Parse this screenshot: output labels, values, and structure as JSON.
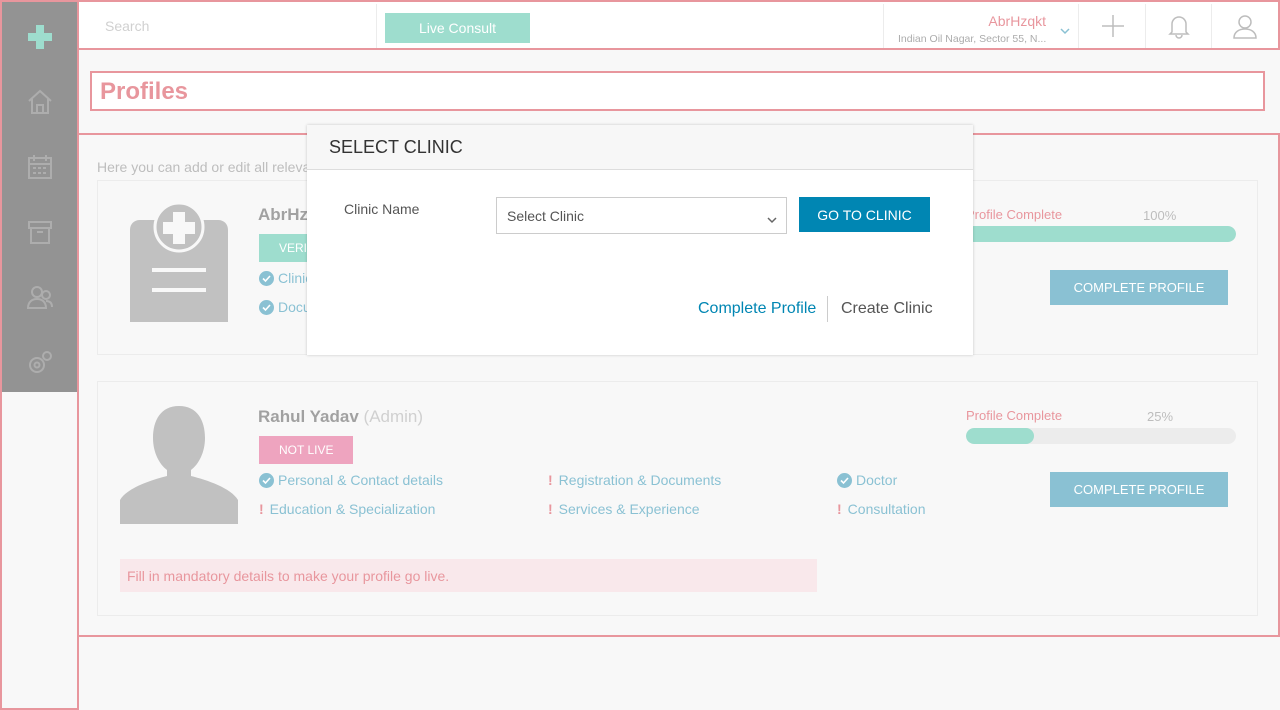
{
  "topbar": {
    "search_placeholder": "Search",
    "live_consult_label": "Live Consult",
    "account_name": "AbrHzqkt",
    "account_address": "Indian Oil Nagar, Sector 55, N..."
  },
  "sidebar": {
    "items": [
      {
        "icon": "logo-cross-icon"
      },
      {
        "icon": "home-icon"
      },
      {
        "icon": "calendar-icon"
      },
      {
        "icon": "archive-icon"
      },
      {
        "icon": "people-icon"
      },
      {
        "icon": "settings-gear-icon"
      }
    ]
  },
  "page": {
    "title": "Profiles",
    "intro": "Here you can add or edit all relevan"
  },
  "profiles": [
    {
      "name": "AbrHz",
      "badge": "VERI",
      "items": [
        "Clinic",
        "Docu"
      ],
      "progress_label": "Profile Complete",
      "progress_pct_text": "100%",
      "progress": 1.0,
      "button": "COMPLETE PROFILE"
    },
    {
      "name": "Rahul Yadav",
      "role": "(Admin)",
      "badge": "NOT LIVE",
      "items": [
        {
          "label": "Personal & Contact details",
          "status": "done"
        },
        {
          "label": "Registration & Documents",
          "status": "missing"
        },
        {
          "label": "Doctor",
          "status": "done"
        },
        {
          "label": "Education & Specialization",
          "status": "missing"
        },
        {
          "label": "Services & Experience",
          "status": "missing"
        },
        {
          "label": "Consultation",
          "status": "missing"
        }
      ],
      "progress_label": "Profile Complete",
      "progress_pct_text": "25%",
      "progress": 0.25,
      "button": "COMPLETE PROFILE",
      "warning": "Fill in mandatory details to make your profile go live."
    }
  ],
  "modal": {
    "title": "SELECT CLINIC",
    "field_label": "Clinic Name",
    "select_value": "Select Clinic",
    "go_button": "GO TO CLINIC",
    "link_complete": "Complete Profile",
    "link_create": "Create Clinic"
  },
  "colors": {
    "accent_red": "#d6404e",
    "teal": "#4fc1a6",
    "blue": "#0086b3",
    "pink": "#e05a8a",
    "sidebar_dark": "#3b3b3b"
  }
}
